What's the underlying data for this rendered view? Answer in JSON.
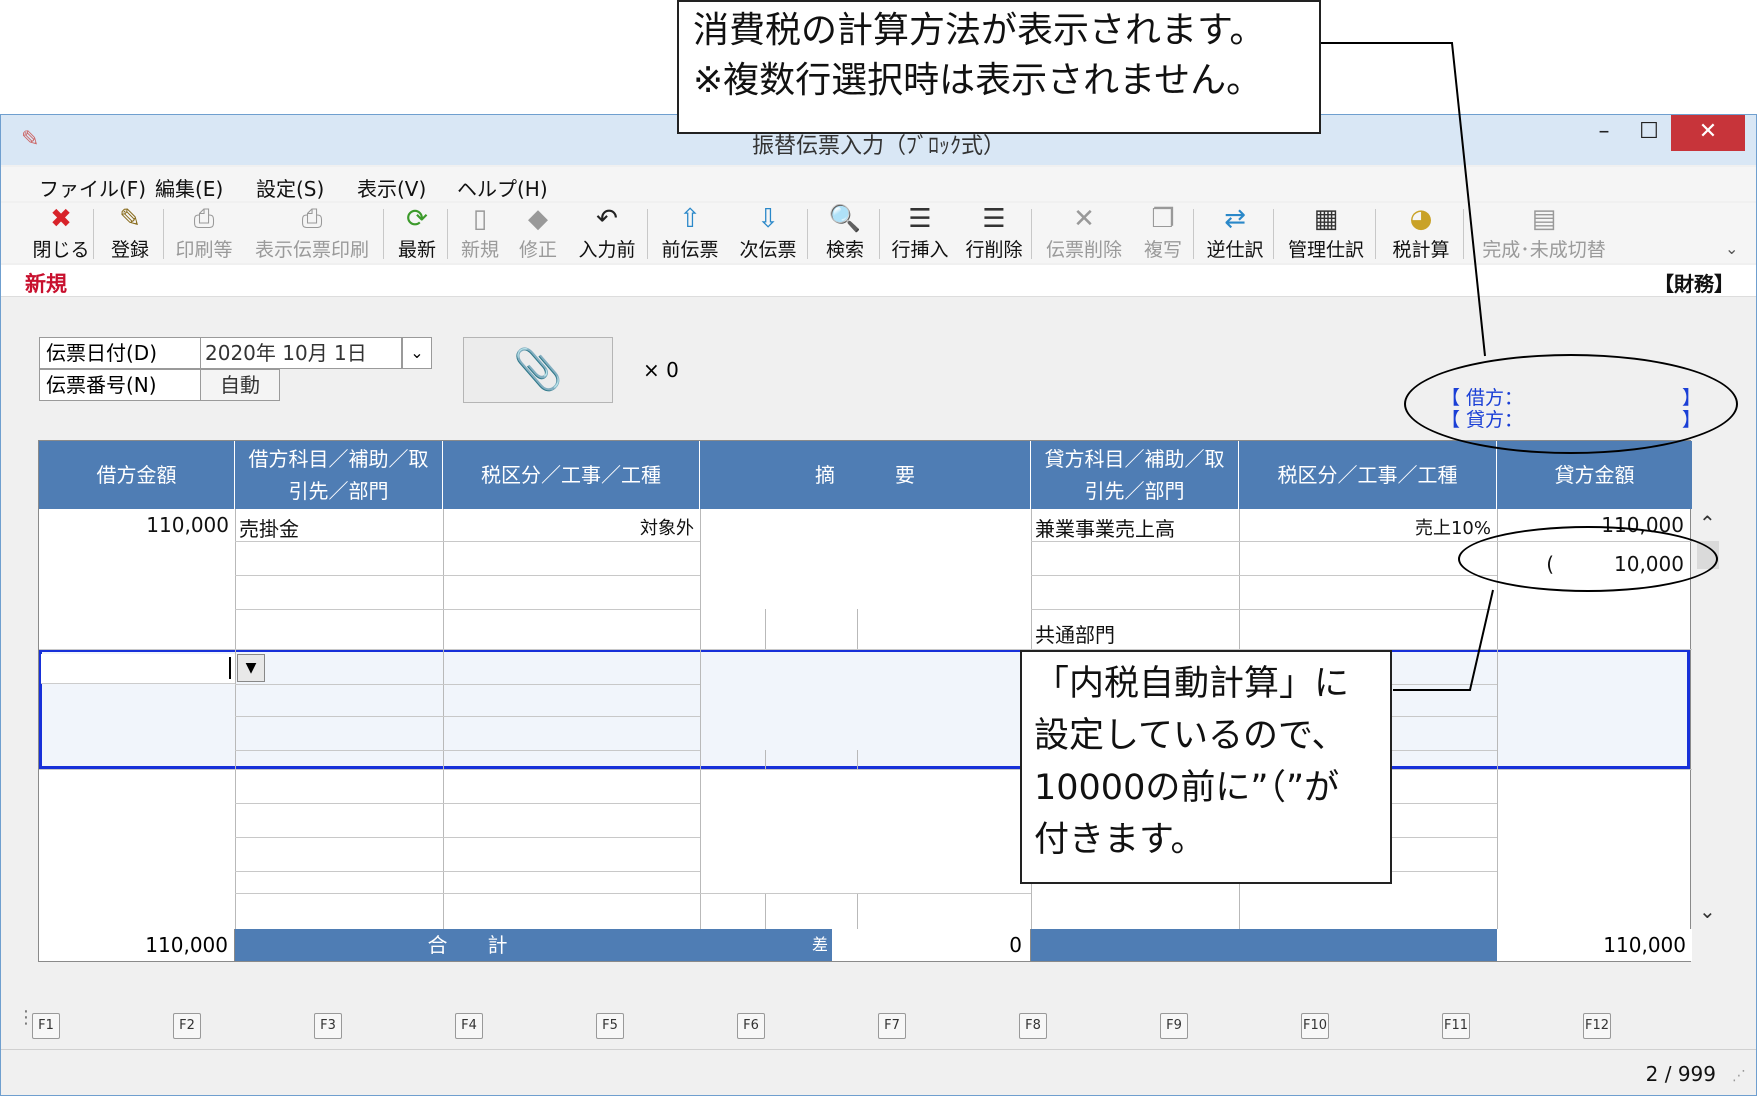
{
  "window": {
    "title": "振替伝票入力（ﾌﾞﾛｯｸ式）",
    "minimize": "–",
    "maximize": "☐",
    "close": "✕"
  },
  "menu": [
    "ファイル(F)",
    "編集(E)",
    "設定(S)",
    "表示(V)",
    "ヘルプ(H)"
  ],
  "toolbar": [
    {
      "label": "閉じる",
      "icon": "close-icon",
      "glyph": "✖",
      "enabled": true,
      "color": "#d8232a"
    },
    {
      "label": "登録",
      "icon": "register-icon",
      "glyph": "✎",
      "enabled": true,
      "color": "#8a6d1f"
    },
    {
      "label": "印刷等",
      "icon": "print-icon",
      "glyph": "⎙",
      "enabled": false,
      "color": "#999"
    },
    {
      "label": "表示伝票印刷",
      "icon": "print-display-icon",
      "glyph": "⎙",
      "enabled": false,
      "color": "#999"
    },
    {
      "label": "最新",
      "icon": "refresh-icon",
      "glyph": "⟳",
      "enabled": true,
      "color": "#3c9a2b"
    },
    {
      "label": "新規",
      "icon": "new-doc-icon",
      "glyph": "▯",
      "enabled": false,
      "color": "#999"
    },
    {
      "label": "修正",
      "icon": "eraser-icon",
      "glyph": "◆",
      "enabled": false,
      "color": "#999"
    },
    {
      "label": "入力前",
      "icon": "undo-doc-icon",
      "glyph": "↶",
      "enabled": true,
      "color": "#222"
    },
    {
      "label": "前伝票",
      "icon": "prev-slip-icon",
      "glyph": "⇧",
      "enabled": true,
      "color": "#2a88c9"
    },
    {
      "label": "次伝票",
      "icon": "next-slip-icon",
      "glyph": "⇩",
      "enabled": true,
      "color": "#2a88c9"
    },
    {
      "label": "検索",
      "icon": "search-icon",
      "glyph": "🔍",
      "enabled": true,
      "color": "#333"
    },
    {
      "label": "行挿入",
      "icon": "row-insert-icon",
      "glyph": "☰",
      "enabled": true,
      "color": "#333"
    },
    {
      "label": "行削除",
      "icon": "row-delete-icon",
      "glyph": "☰",
      "enabled": true,
      "color": "#333"
    },
    {
      "label": "伝票削除",
      "icon": "slip-delete-icon",
      "glyph": "✕",
      "enabled": false,
      "color": "#999"
    },
    {
      "label": "複写",
      "icon": "copy-icon",
      "glyph": "❐",
      "enabled": false,
      "color": "#999"
    },
    {
      "label": "逆仕訳",
      "icon": "reverse-entry-icon",
      "glyph": "⇄",
      "enabled": true,
      "color": "#2a88c9"
    },
    {
      "label": "管理仕訳",
      "icon": "manage-entry-icon",
      "glyph": "▦",
      "enabled": true,
      "color": "#333"
    },
    {
      "label": "税計算",
      "icon": "tax-calc-icon",
      "glyph": "◕",
      "enabled": true,
      "color": "#c9a227"
    },
    {
      "label": "完成･未成切替",
      "icon": "complete-toggle-icon",
      "glyph": "▤",
      "enabled": false,
      "color": "#999"
    }
  ],
  "mode": {
    "label": "新規",
    "finance": "【財務】"
  },
  "header": {
    "date_label": "伝票日付(D)",
    "date_value": "2020年 10月  1日",
    "number_label": "伝票番号(N)",
    "number_value": "自動",
    "attach_count": "× 0"
  },
  "tax_info": {
    "debit": "【 借方：",
    "credit": "【 貸方：",
    "close_bracket": "】"
  },
  "grid": {
    "headers": {
      "debit_amount": "借方金額",
      "debit_account": "借方科目／補助／取引先／部門",
      "debit_tax": "税区分／工事／工種",
      "summary": "摘　　　要",
      "credit_account": "貸方科目／補助／取引先／部門",
      "credit_tax": "税区分／工事／工種",
      "credit_amount": "貸方金額"
    },
    "row1": {
      "debit_amount": "110,000",
      "debit_account": "売掛金",
      "debit_tax": "対象外",
      "credit_account": "兼業事業売上高",
      "credit_tax": "売上10%",
      "credit_amount": "110,000",
      "credit_tax_amount": "(　　　10,000",
      "credit_dept": "共通部門"
    },
    "total": {
      "debit": "110,000",
      "label": "合　　計",
      "diff_mark": "差",
      "diff": "0",
      "credit": "110,000"
    }
  },
  "fkeys": [
    "F1",
    "F2",
    "F3",
    "F4",
    "F5",
    "F6",
    "F7",
    "F8",
    "F9",
    "F10",
    "F11",
    "F12"
  ],
  "status": {
    "page": "2 / 999"
  },
  "callouts": {
    "top": [
      "消費税の計算方法が表示されます。",
      "※複数行選択時は表示されません。"
    ],
    "bottom": [
      "「内税自動計算」に",
      "設定しているので、",
      "10000の前に”（”が",
      "付きます。"
    ]
  }
}
